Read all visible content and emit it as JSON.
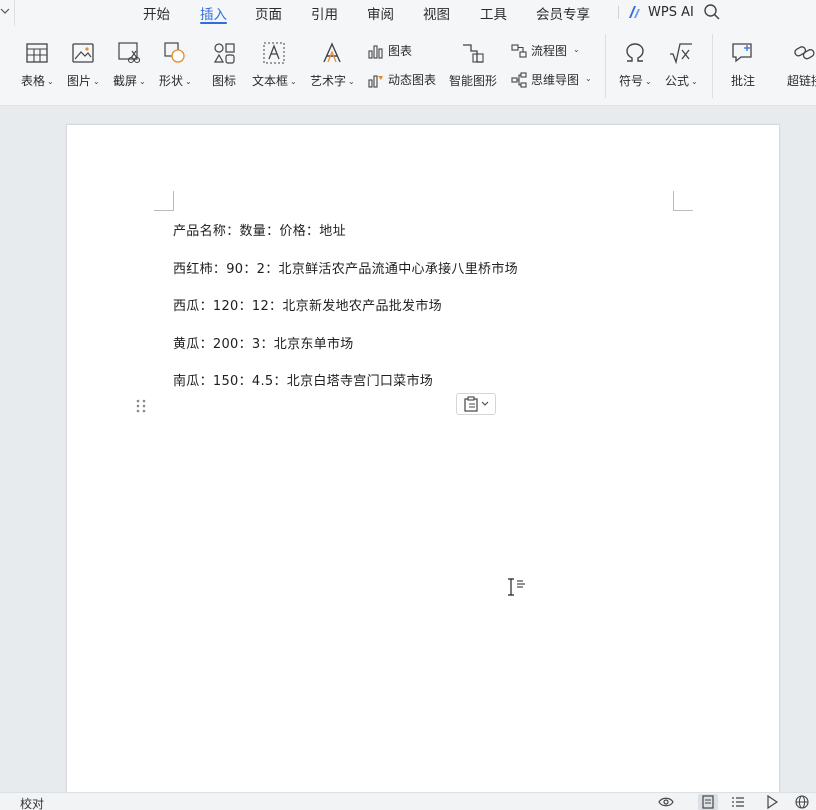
{
  "menu": {
    "tabs": [
      "开始",
      "插入",
      "页面",
      "引用",
      "审阅",
      "视图",
      "工具",
      "会员专享"
    ],
    "active_tab": "插入",
    "wps_ai": "WPS AI"
  },
  "ribbon": {
    "table": "表格",
    "picture": "图片",
    "screenshot": "截屏",
    "shape": "形状",
    "icons": "图标",
    "textbox": "文本框",
    "wordart": "艺术字",
    "chart": "图表",
    "dynamic_chart": "动态图表",
    "smart_graphic": "智能图形",
    "flowchart": "流程图",
    "mindmap": "思维导图",
    "symbol": "符号",
    "formula": "公式",
    "comment": "批注",
    "hyperlink": "超链接"
  },
  "document": {
    "lines": [
      "产品名称：数量：价格：地址",
      "西红柿：90：2：北京鲜活农产品流通中心承接八里桥市场",
      "西瓜：120：12：北京新发地农产品批发市场",
      "黄瓜：200：3：北京东单市场",
      "南瓜：150：4.5：北京白塔寺宫门口菜市场"
    ]
  },
  "statusbar": {
    "proofread": "校对"
  },
  "colors": {
    "accent": "#2f6ddf",
    "page_bg": "#ffffff",
    "workspace_bg": "#e8ebee"
  }
}
